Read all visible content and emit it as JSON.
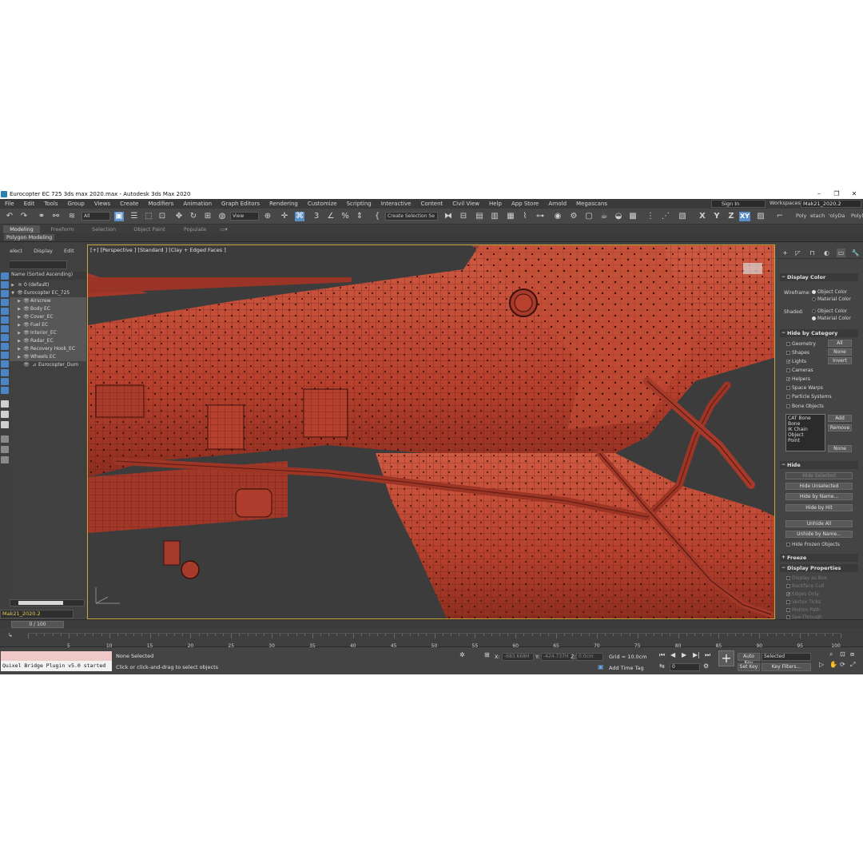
{
  "window": {
    "title": "Eurocopter EC 725 3ds max 2020.max - Autodesk 3ds Max 2020",
    "minimize": "–",
    "maximize": "❐",
    "close": "✕"
  },
  "menubar": {
    "items": [
      "File",
      "Edit",
      "Tools",
      "Group",
      "Views",
      "Create",
      "Modifiers",
      "Animation",
      "Graph Editors",
      "Rendering",
      "Customize",
      "Scripting",
      "Interactive",
      "Content",
      "Civil View",
      "Help",
      "App Store",
      "Arnold",
      "Megascans"
    ],
    "sign_in": "Sign In",
    "workspaces_label": "Workspaces:",
    "workspace_value": "Mak21_2020.2"
  },
  "toolbar": {
    "selection_filter": "All",
    "ref_coord": "View",
    "named_selection": "Create Selection Se",
    "axis_x": "X",
    "axis_y": "Y",
    "axis_z": "Z",
    "axis_xy": "XY",
    "poly_label": "Poly",
    "etach_label": "etach",
    "polyda_label": "'olyDa",
    "polyl_label": "Polyl"
  },
  "ribbon": {
    "tabs": [
      "Modeling",
      "Freeform",
      "Selection",
      "Object Paint",
      "Populate"
    ],
    "active_tab": "Modeling",
    "sub_panel": "Polygon Modeling"
  },
  "scene_explorer": {
    "menu": [
      "Select",
      "Display",
      "Edit"
    ],
    "header": "Name (Sorted Ascending)",
    "rows": [
      {
        "label": "0 (default)",
        "indent": 0,
        "selected": false
      },
      {
        "label": "Eurocopter EC_725",
        "indent": 0,
        "selected": false
      },
      {
        "label": "Airscrew",
        "indent": 1,
        "selected": true
      },
      {
        "label": "Body EC",
        "indent": 1,
        "selected": true
      },
      {
        "label": "Cover_EC",
        "indent": 1,
        "selected": true
      },
      {
        "label": "Fuel EC",
        "indent": 1,
        "selected": true
      },
      {
        "label": "Interior_EC",
        "indent": 1,
        "selected": true
      },
      {
        "label": "Radar_EC",
        "indent": 1,
        "selected": true
      },
      {
        "label": "Recovery Hook_EC",
        "indent": 1,
        "selected": true
      },
      {
        "label": "Wheels EC",
        "indent": 1,
        "selected": true
      },
      {
        "label": "Eurocopter_Dum",
        "indent": 1,
        "selected": false
      }
    ],
    "layer": "Mak21_2020.2"
  },
  "viewport": {
    "label": "[+] [Perspective ] [Standard ] [Clay + Edged Faces ]",
    "mesh_color": "#b8412e",
    "wire_color": "#5a1a12",
    "background": "#3c3c3c"
  },
  "command_panel": {
    "display_color": {
      "title": "Display Color",
      "wireframe_label": "Wireframe:",
      "shaded_label": "Shaded:",
      "object_color": "Object Color",
      "material_color": "Material Color"
    },
    "hide_by_category": {
      "title": "Hide by Category",
      "items": [
        {
          "label": "Geometry",
          "checked": false
        },
        {
          "label": "Shapes",
          "checked": false
        },
        {
          "label": "Lights",
          "checked": true
        },
        {
          "label": "Cameras",
          "checked": false
        },
        {
          "label": "Helpers",
          "checked": true
        },
        {
          "label": "Space Warps",
          "checked": false
        },
        {
          "label": "Particle Systems",
          "checked": false
        },
        {
          "label": "Bone Objects",
          "checked": false
        }
      ],
      "btn_all": "All",
      "btn_none": "None",
      "btn_invert": "Invert",
      "list": [
        "CAT Bone",
        "Bone",
        "IK Chain Object",
        "Point"
      ],
      "btn_add": "Add",
      "btn_remove": "Remove",
      "btn_none2": "None"
    },
    "hide": {
      "title": "Hide",
      "buttons": [
        "Hide Selected",
        "Hide Unselected",
        "Hide by Name...",
        "Hide by Hit",
        "Unhide All",
        "Unhide by Name..."
      ],
      "frozen": "Hide Frozen Objects"
    },
    "freeze": {
      "title": "Freeze"
    },
    "display_properties": {
      "title": "Display Properties",
      "items": [
        {
          "label": "Display as Box",
          "checked": false
        },
        {
          "label": "Backface Cull",
          "checked": false
        },
        {
          "label": "Edges Only",
          "checked": true
        },
        {
          "label": "Vertex Ticks",
          "checked": false
        },
        {
          "label": "Motion Path",
          "checked": false
        },
        {
          "label": "See-Through",
          "checked": false
        }
      ]
    }
  },
  "timeline": {
    "frame": "0 / 100",
    "ticks": [
      "5",
      "10",
      "15",
      "20",
      "25",
      "30",
      "35",
      "40",
      "45",
      "50",
      "55",
      "60",
      "65",
      "70",
      "75",
      "80",
      "85",
      "90",
      "95",
      "100"
    ],
    "start": "0"
  },
  "status": {
    "maxscript": "Quixel Bridge Plugin v5.0 started",
    "selection": "None Selected",
    "prompt": "Click or click-and-drag to select objects",
    "x_label": "X:",
    "x_value": "-683.668H",
    "y_label": "Y:",
    "y_value": "-424.737H",
    "z_label": "Z:",
    "z_value": "0.0cm",
    "grid": "Grid = 10.0cm",
    "add_time_tag": "Add Time Tag",
    "auto_key": "Auto Key",
    "set_key": "Set Key",
    "key_mode": "Selected",
    "key_filters": "Key Filters...",
    "frame_field": "0"
  }
}
